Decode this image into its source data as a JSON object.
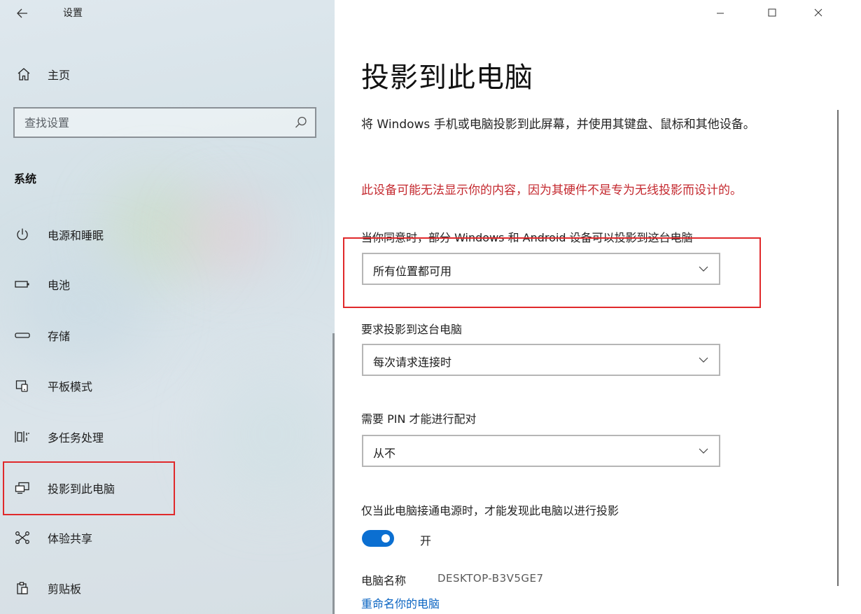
{
  "window": {
    "title": "设置",
    "back_icon": "arrow-left-icon",
    "controls": {
      "minimize": "—",
      "maximize": "☐",
      "close": "✕"
    }
  },
  "sidebar": {
    "home_label": "主页",
    "search_placeholder": "查找设置",
    "section_title": "系统",
    "items": [
      {
        "label": "电源和睡眠",
        "icon": "power-icon"
      },
      {
        "label": "电池",
        "icon": "battery-icon"
      },
      {
        "label": "存储",
        "icon": "storage-icon"
      },
      {
        "label": "平板模式",
        "icon": "tablet-mode-icon"
      },
      {
        "label": "多任务处理",
        "icon": "multitasking-icon"
      },
      {
        "label": "投影到此电脑",
        "icon": "project-icon",
        "selected": true
      },
      {
        "label": "体验共享",
        "icon": "shared-experiences-icon"
      },
      {
        "label": "剪贴板",
        "icon": "clipboard-icon"
      }
    ]
  },
  "main": {
    "title": "投影到此电脑",
    "description": "将 Windows 手机或电脑投影到此屏幕，并使用其键盘、鼠标和其他设备。",
    "warning": "此设备可能无法显示你的内容，因为其硬件不是专为无线投影而设计的。",
    "availability": {
      "label": "当你同意时，部分 Windows 和 Android 设备可以投影到这台电脑",
      "value": "所有位置都可用"
    },
    "ask_to_project": {
      "label": "要求投影到这台电脑",
      "value": "每次请求连接时"
    },
    "require_pin": {
      "label": "需要 PIN 才能进行配对",
      "value": "从不"
    },
    "power_discovery": {
      "label": "仅当此电脑接通电源时，才能发现此电脑以进行投影",
      "toggle_state": "开",
      "on": true
    },
    "pc_name": {
      "label": "电脑名称",
      "value": "DESKTOP-B3V5GE7"
    },
    "rename_link": "重命名你的电脑"
  },
  "colors": {
    "accent": "#0b6fd1",
    "warning": "#c4292f",
    "highlight": "#e0292b",
    "link": "#0a64c2"
  }
}
